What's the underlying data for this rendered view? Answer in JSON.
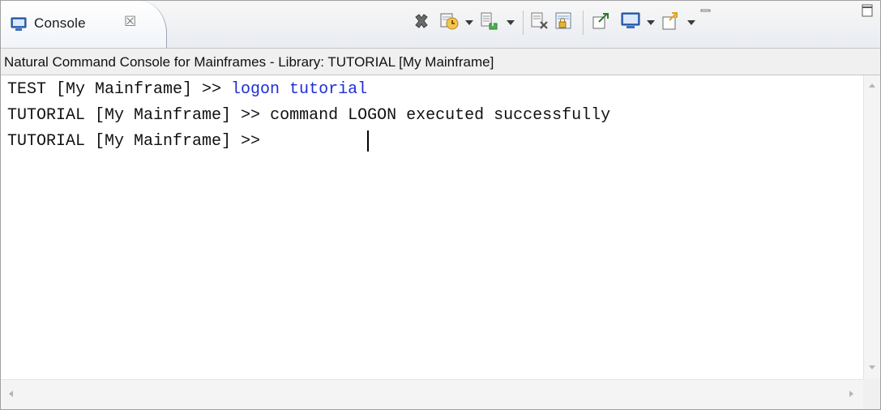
{
  "tab": {
    "label": "Console",
    "close_glyph": "☒"
  },
  "toolbar": {
    "icons": [
      "terminate-icon",
      "scroll-lock-icon",
      "pin-console-icon",
      "clear-console-icon",
      "word-wrap-icon",
      "display-selected-console-icon",
      "open-console-icon",
      "open-new-console-icon",
      "minimize-icon",
      "maximize-icon"
    ]
  },
  "console": {
    "title": "Natural Command Console for Mainframes - Library: TUTORIAL [My Mainframe]",
    "lines": [
      {
        "prompt": "TEST [My Mainframe] >> ",
        "command": "logon tutorial"
      },
      {
        "prompt": "TUTORIAL [My Mainframe] >> ",
        "output": "command LOGON executed successfully"
      },
      {
        "prompt": "TUTORIAL [My Mainframe] >> "
      }
    ]
  },
  "colors": {
    "command_text": "#1f2fd6",
    "plain_text": "#111111",
    "tab_background": "#ffffff",
    "title_background": "#f0f0f0"
  }
}
